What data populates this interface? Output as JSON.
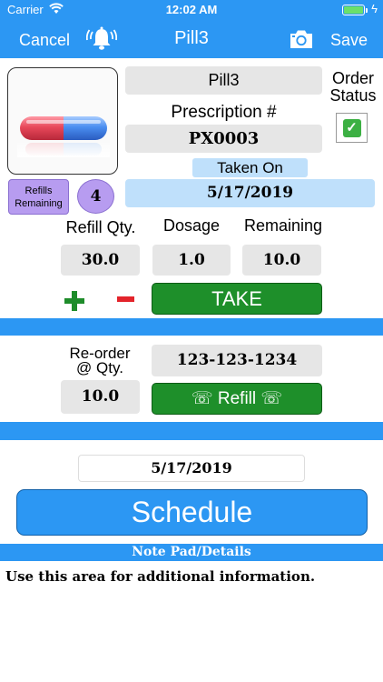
{
  "status_bar": {
    "carrier": "Carrier",
    "time": "12:02 AM",
    "battery_level": 1.0,
    "charging_symbol": "ϟ"
  },
  "navbar": {
    "cancel_label": "Cancel",
    "title": "Pill3",
    "save_label": "Save",
    "icons": [
      "bell-alarm-icon",
      "camera-icon"
    ]
  },
  "medication": {
    "name": "Pill3",
    "prescription_label": "Prescription #",
    "prescription_number": "PX0003",
    "taken_on_label": "Taken On",
    "taken_on_date": "5/17/2019",
    "order_status_label": "Order\nStatus",
    "order_status_checked": true,
    "order_status_symbol": "✓"
  },
  "refills": {
    "label": "Refills\nRemaining",
    "count": "4"
  },
  "quantities": {
    "refill_qty_label": "Refill Qty.",
    "dosage_label": "Dosage",
    "remaining_label": "Remaining",
    "refill_qty_value": "30.0",
    "dosage_value": "1.0",
    "remaining_value": "10.0",
    "take_label": "TAKE"
  },
  "reorder": {
    "label": "Re-order\n@ Qty.",
    "qty_value": "10.0",
    "phone": "123-123-1234",
    "refill_button_label": "☏ Refill ☏"
  },
  "schedule": {
    "date": "5/17/2019",
    "button_label": "Schedule"
  },
  "notepad": {
    "header": "Note Pad/Details",
    "text": "Use this area for additional information."
  },
  "colors": {
    "primary_blue": "#2c97f3",
    "light_blue_field": "#bfe0fb",
    "field_gray": "#e6e6e6",
    "action_green": "#1e8f2a",
    "plus_green": "#1e8c2a",
    "minus_red": "#e3242b",
    "refills_purple": "#b79cf0",
    "check_green": "#3cb043"
  }
}
